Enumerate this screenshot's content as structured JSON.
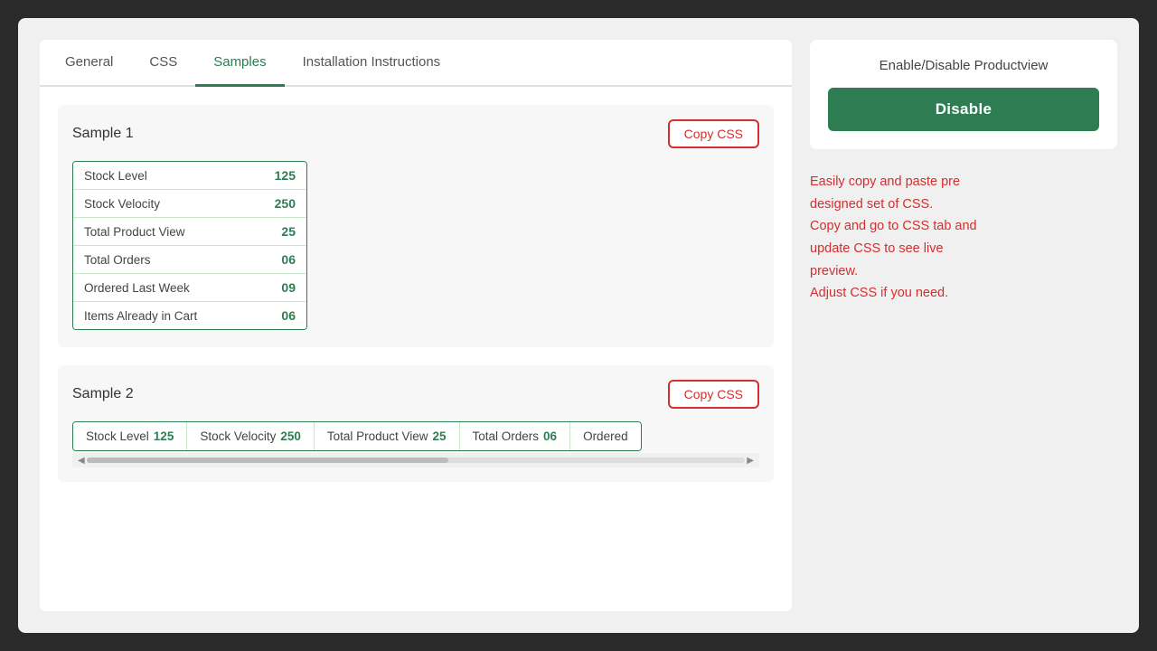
{
  "tabs": [
    {
      "id": "general",
      "label": "General",
      "active": false
    },
    {
      "id": "css",
      "label": "CSS",
      "active": false
    },
    {
      "id": "samples",
      "label": "Samples",
      "active": true
    },
    {
      "id": "installation",
      "label": "Installation Instructions",
      "active": false
    }
  ],
  "sample1": {
    "title": "Sample 1",
    "copy_btn": "Copy CSS",
    "rows": [
      {
        "label": "Stock Level",
        "value": "125"
      },
      {
        "label": "Stock Velocity",
        "value": "250"
      },
      {
        "label": "Total Product View",
        "value": "25"
      },
      {
        "label": "Total Orders",
        "value": "06"
      },
      {
        "label": "Ordered Last Week",
        "value": "09"
      },
      {
        "label": "Items Already in Cart",
        "value": "06"
      }
    ]
  },
  "sample2": {
    "title": "Sample 2",
    "copy_btn": "Copy CSS",
    "cells": [
      {
        "label": "Stock Level",
        "value": "125"
      },
      {
        "label": "Stock Velocity",
        "value": "250"
      },
      {
        "label": "Total Product View",
        "value": "25"
      },
      {
        "label": "Total Orders",
        "value": "06"
      },
      {
        "label": "Ordered",
        "value": ""
      }
    ]
  },
  "right_panel": {
    "card_title": "Enable/Disable Productview",
    "disable_btn": "Disable",
    "annotation": "Easily copy and paste pre designed set of CSS.\nCopy and go to CSS tab and update CSS to see live preview.\nAdjust CSS if you need."
  }
}
